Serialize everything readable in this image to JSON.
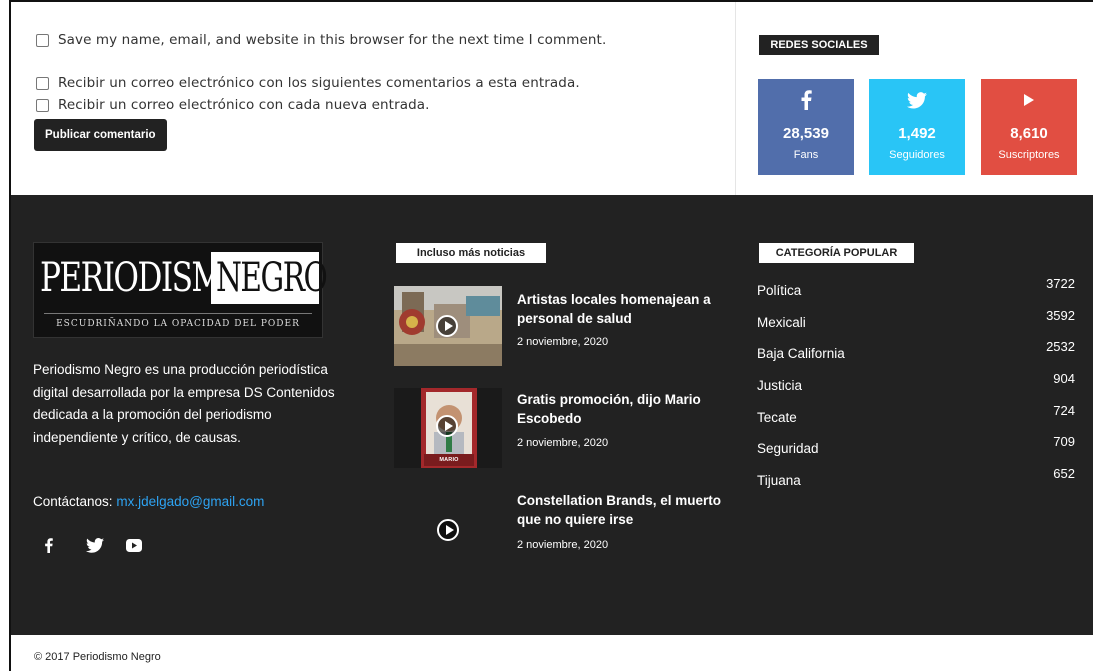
{
  "comment_form": {
    "save_info_label": "Save my name, email, and website in this browser for the next time I comment.",
    "notify_comments_label": "Recibir un correo electrónico con los siguientes comentarios a esta entrada.",
    "notify_posts_label": "Recibir un correo electrónico con cada nueva entrada.",
    "submit_label": "Publicar comentario"
  },
  "social_widget": {
    "title": "REDES SOCIALES",
    "cards": [
      {
        "icon": "facebook-icon",
        "count": "28,539",
        "label": "Fans",
        "color": "#516eab"
      },
      {
        "icon": "twitter-icon",
        "count": "1,492",
        "label": "Seguidores",
        "color": "#29c5f6"
      },
      {
        "icon": "youtube-icon",
        "count": "8,610",
        "label": "Suscriptores",
        "color": "#e14e42"
      }
    ]
  },
  "footer": {
    "logo": {
      "word1": "PERIODISMO",
      "word2": "NEGRO",
      "tagline": "ESCUDRIÑANDO LA OPACIDAD DEL PODER"
    },
    "about": "Periodismo Negro es una producción periodística digital desarrollada por la empresa DS Contenidos dedicada a la promoción del periodismo independiente y crítico, de causas.",
    "contact_label": "Contáctanos:",
    "contact_email": "mx.jdelgado@gmail.com",
    "social_icons": [
      "facebook-icon",
      "twitter-icon",
      "youtube-icon"
    ],
    "news_title": "Incluso más noticias",
    "news": [
      {
        "title": "Artistas locales homenajean a personal de salud",
        "date": "2 noviembre, 2020"
      },
      {
        "title": "Gratis promoción, dijo Mario Escobedo",
        "date": "2 noviembre, 2020"
      },
      {
        "title": "Constellation Brands, el muerto que no quiere irse",
        "date": "2 noviembre, 2020"
      }
    ],
    "categories_title": "CATEGORÍA POPULAR",
    "categories": [
      {
        "name": "Política",
        "count": "3722"
      },
      {
        "name": "Mexicali",
        "count": "3592"
      },
      {
        "name": "Baja California",
        "count": "2532"
      },
      {
        "name": "Justicia",
        "count": "904"
      },
      {
        "name": "Tecate",
        "count": "724"
      },
      {
        "name": "Seguridad",
        "count": "709"
      },
      {
        "name": "Tijuana",
        "count": "652"
      }
    ],
    "thumb2_caption": "MARIO ESCOBEDO"
  },
  "copyright": "© 2017 Periodismo Negro",
  "colors": {
    "footer_bg": "#222222",
    "link": "#2ea3f2"
  }
}
